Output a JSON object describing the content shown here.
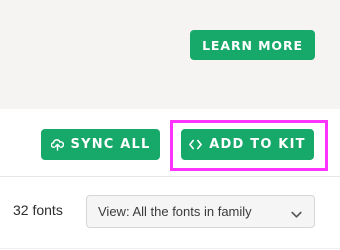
{
  "promo": {
    "learn_more_label": "LEARN MORE"
  },
  "actions": {
    "sync_all_label": "SYNC ALL",
    "add_to_kit_label": "ADD TO KIT",
    "sync_icon": "cloud-sync-icon",
    "add_icon": "code-brackets-icon"
  },
  "fonts": {
    "count_label": "32 fonts",
    "view_select_value": "View: All the fonts in family"
  },
  "colors": {
    "accent": "#16a96a",
    "highlight": "#ff33ff"
  }
}
